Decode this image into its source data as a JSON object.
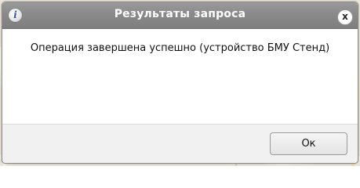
{
  "dialog": {
    "title": "Результаты запроса",
    "info_icon": "info-icon",
    "close_label": "x",
    "message": "Операция завершена успешно (устройство БМУ Стенд)",
    "ok_label": "Ок"
  },
  "colors": {
    "titlebar": "#8a8a8a",
    "footer": "#f1f1f1",
    "map_background": "#e8e4d6"
  }
}
